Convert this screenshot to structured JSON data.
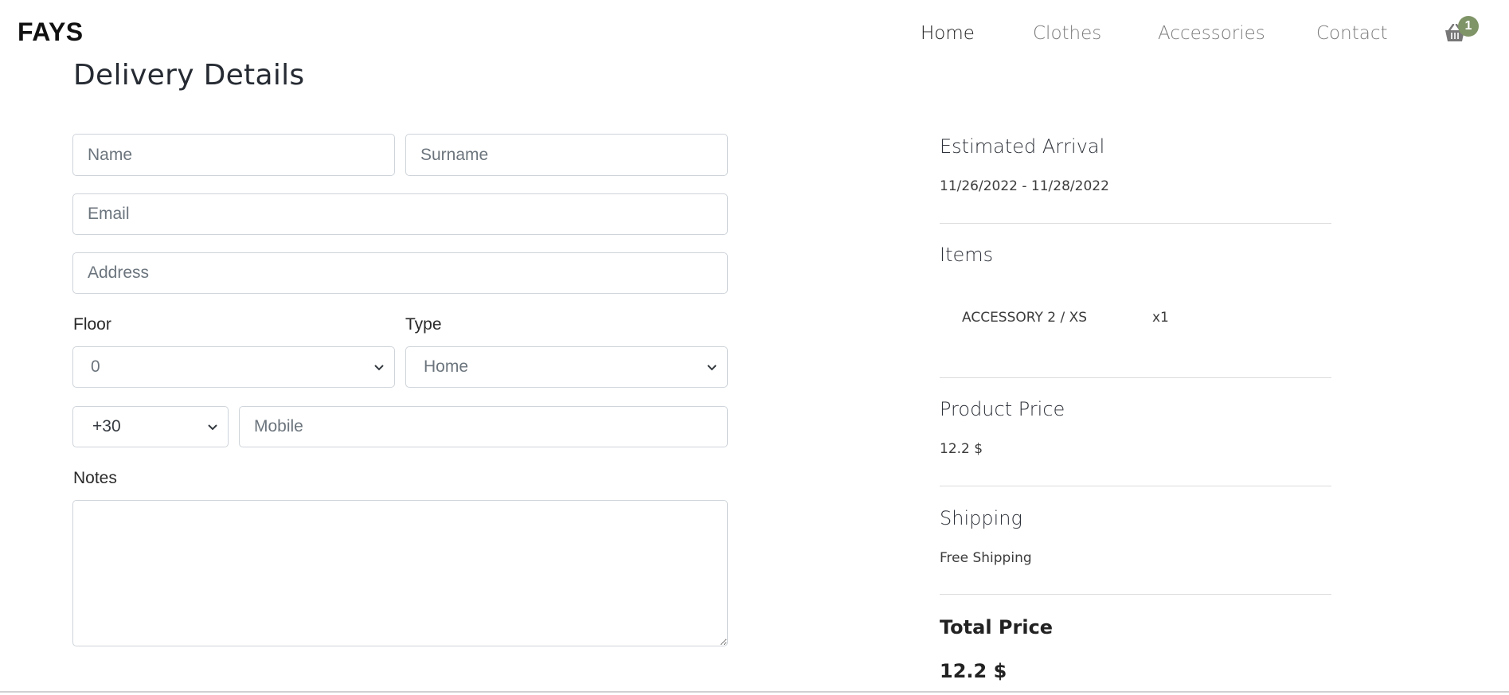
{
  "nav": {
    "brand": "FAYS",
    "links": [
      "Home",
      "Clothes",
      "Accessories",
      "Contact"
    ],
    "active": "Home",
    "cart_count": "1",
    "cart_icon": "basket-icon",
    "badge_color": "#7f9467"
  },
  "form": {
    "title": "Delivery Details",
    "name_placeholder": "Name",
    "surname_placeholder": "Surname",
    "email_placeholder": "Email",
    "address_placeholder": "Address",
    "floor_label": "Floor",
    "floor_value": "0",
    "type_label": "Type",
    "type_value": "Home",
    "country_code_value": "+30",
    "mobile_placeholder": "Mobile",
    "notes_label": "Notes",
    "notes_value": ""
  },
  "summary": {
    "arrival_title": "Estimated Arrival",
    "arrival_value": "11/26/2022 - 11/28/2022",
    "items_title": "Items",
    "items": [
      {
        "name": "ACCESSORY 2 / XS",
        "qty": "x1"
      }
    ],
    "product_price_title": "Product Price",
    "product_price_value": "12.2 $",
    "shipping_title": "Shipping",
    "shipping_value": "Free Shipping",
    "total_title": "Total Price",
    "total_value": "12.2 $"
  }
}
